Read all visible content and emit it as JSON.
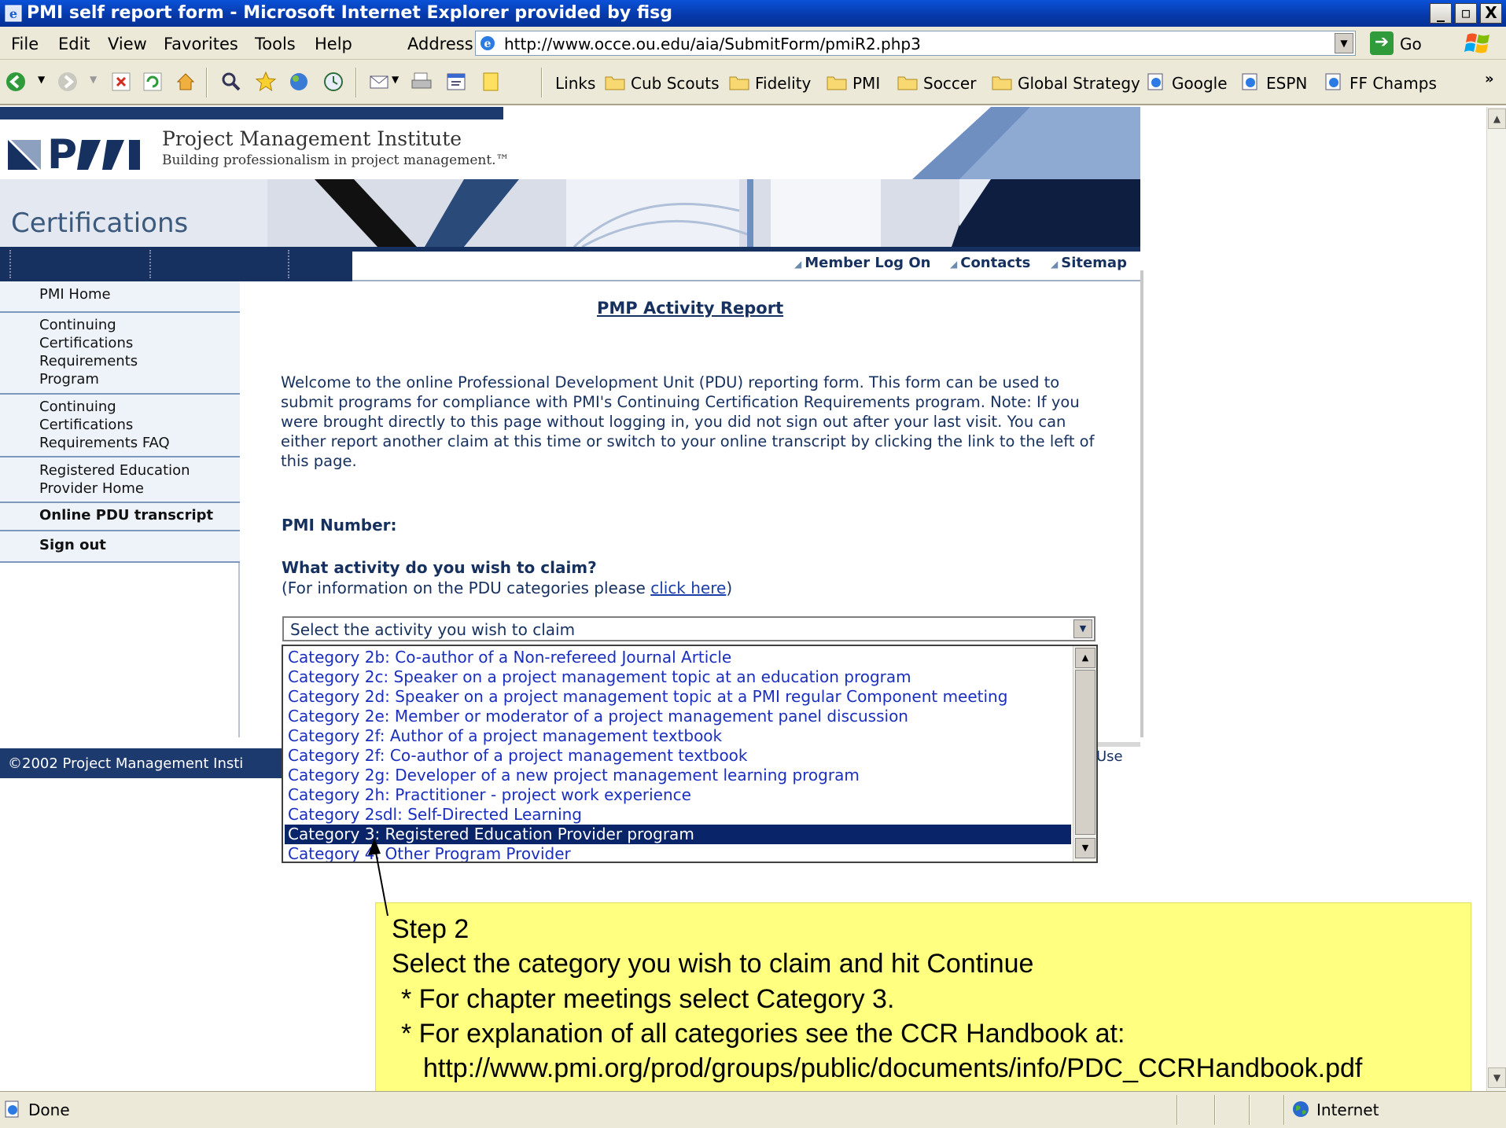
{
  "window": {
    "title": "PMI self report form - Microsoft Internet Explorer provided by fisg",
    "minimize": "_",
    "maximize": "▫",
    "close": "X"
  },
  "menu": {
    "items": [
      "File",
      "Edit",
      "View",
      "Favorites",
      "Tools",
      "Help"
    ],
    "address_label": "Address",
    "url": "http://www.occe.ou.edu/aia/SubmitForm/pmiR2.php3",
    "go_label": "Go"
  },
  "links_bar": {
    "label": "Links",
    "items": [
      "Cub Scouts",
      "Fidelity",
      "PMI",
      "Soccer",
      "Global Strategy",
      "Google",
      "ESPN",
      "FF Champs"
    ],
    "more": "»"
  },
  "header": {
    "org_name": "Project Management Institute",
    "tagline": "Building professionalism in project management.™",
    "section": "Certifications"
  },
  "utility_links": [
    "Member Log On",
    "Contacts",
    "Sitemap"
  ],
  "left_nav": [
    "PMI Home",
    "Continuing Certifications Requirements Program",
    "Continuing Certifications Requirements FAQ",
    "Registered Education Provider Home",
    "Online PDU transcript",
    "Sign out"
  ],
  "main": {
    "title": "PMP Activity Report",
    "welcome": "Welcome to the online Professional Development Unit (PDU) reporting form. This form can be used to submit programs for compliance with PMI's Continuing Certification Requirements program. Note: If you were brought directly to this page without logging in, you did not sign out after your last visit. You can either report another claim at this time or switch to your online transcript by clicking the link to the left of this page.",
    "pmi_number_label": "PMI Number:",
    "activity_question": "What activity do you wish to claim?",
    "pdu_info_prefix": "(For information on the PDU categories please ",
    "pdu_info_link": "click here",
    "pdu_info_suffix": ")",
    "select_value": "Select the activity you wish to claim",
    "options": [
      "Category 2b: Co-author of a Non-refereed Journal Article",
      "Category 2c: Speaker on a project management topic at an education program",
      "Category 2d: Speaker on a project management topic at a PMI regular Component meeting",
      "Category 2e: Member or moderator of a project management panel discussion",
      "Category 2f: Author of a project management textbook",
      "Category 2f: Co-author of a project management textbook",
      "Category 2g: Developer of a new project management learning program",
      "Category 2h: Practitioner - project work experience",
      "Category 2sdl: Self-Directed Learning",
      "Category 3: Registered Education Provider program",
      "Category 4: Other Program Provider"
    ],
    "selected_index": 9
  },
  "footer": {
    "copyright": "©2002 Project Management Insti",
    "right_text": "Use"
  },
  "callout": {
    "step": "Step 2",
    "instruction": "Select the category you wish to claim and hit Continue",
    "bullet1": "* For chapter meetings select Category 3.",
    "bullet2": "* For explanation of all categories see the CCR Handbook at:",
    "url": "http://www.pmi.org/prod/groups/public/documents/info/PDC_CCRHandbook.pdf"
  },
  "status": {
    "text": "Done",
    "zone": "Internet"
  },
  "colors": {
    "navy": "#16305f",
    "selection": "#0a246a",
    "callout_bg": "#ffff80",
    "link": "#1b2fbf"
  }
}
